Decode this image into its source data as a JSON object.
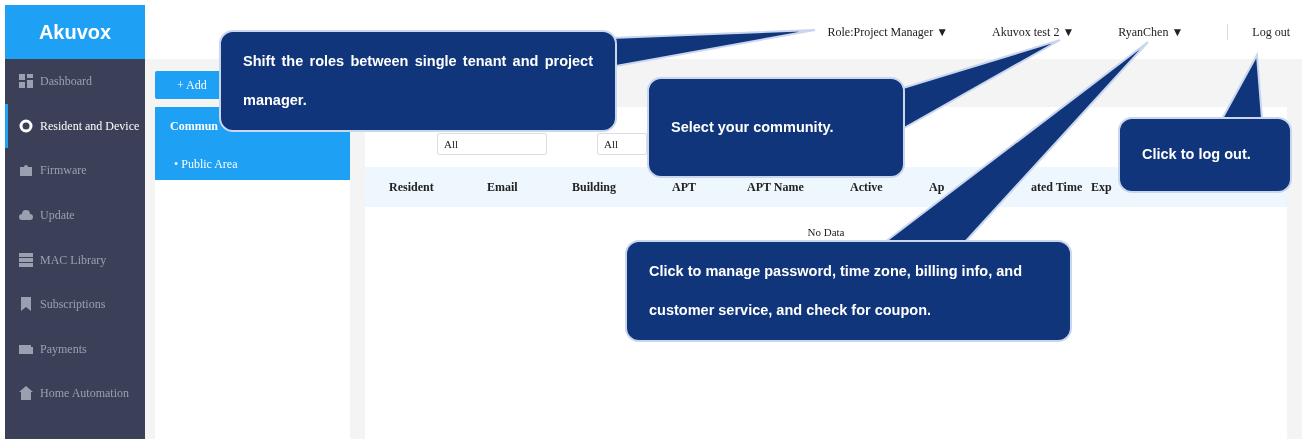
{
  "logo": "Akuvox",
  "header": {
    "menus": [
      {
        "label": "Role:Project Manager",
        "caret": "▼"
      },
      {
        "label": "Akuvox test 2",
        "caret": "▼"
      },
      {
        "label": "RyanChen",
        "caret": "▼"
      }
    ],
    "logout": "Log out"
  },
  "sidebar": {
    "items": [
      {
        "label": "Dashboard",
        "selected": false
      },
      {
        "label": "Resident and Device",
        "selected": true
      },
      {
        "label": "Firmware",
        "selected": false
      },
      {
        "label": "Update",
        "selected": false
      },
      {
        "label": "MAC Library",
        "selected": false
      },
      {
        "label": "Subscriptions",
        "selected": false
      },
      {
        "label": "Payments",
        "selected": false
      },
      {
        "label": "Home Automation",
        "selected": false
      }
    ]
  },
  "left_panel": {
    "add_button": "+ Add",
    "community": {
      "title": "Commun",
      "items": [
        "• Public Area"
      ]
    }
  },
  "filters": [
    {
      "value": "All"
    },
    {
      "value": "All"
    }
  ],
  "table": {
    "columns": [
      "Resident",
      "Email",
      "Building",
      "APT",
      "APT Name",
      "Active",
      "Ap",
      "ated Time",
      "Exp"
    ],
    "empty_text": "No Data"
  },
  "callouts": [
    {
      "text": "Shift the roles between single tenant and project manager."
    },
    {
      "text": "Select your community."
    },
    {
      "text": "Click to manage password, time zone, billing info, and customer service, and check for coupon."
    },
    {
      "text": "Click to log out."
    }
  ]
}
